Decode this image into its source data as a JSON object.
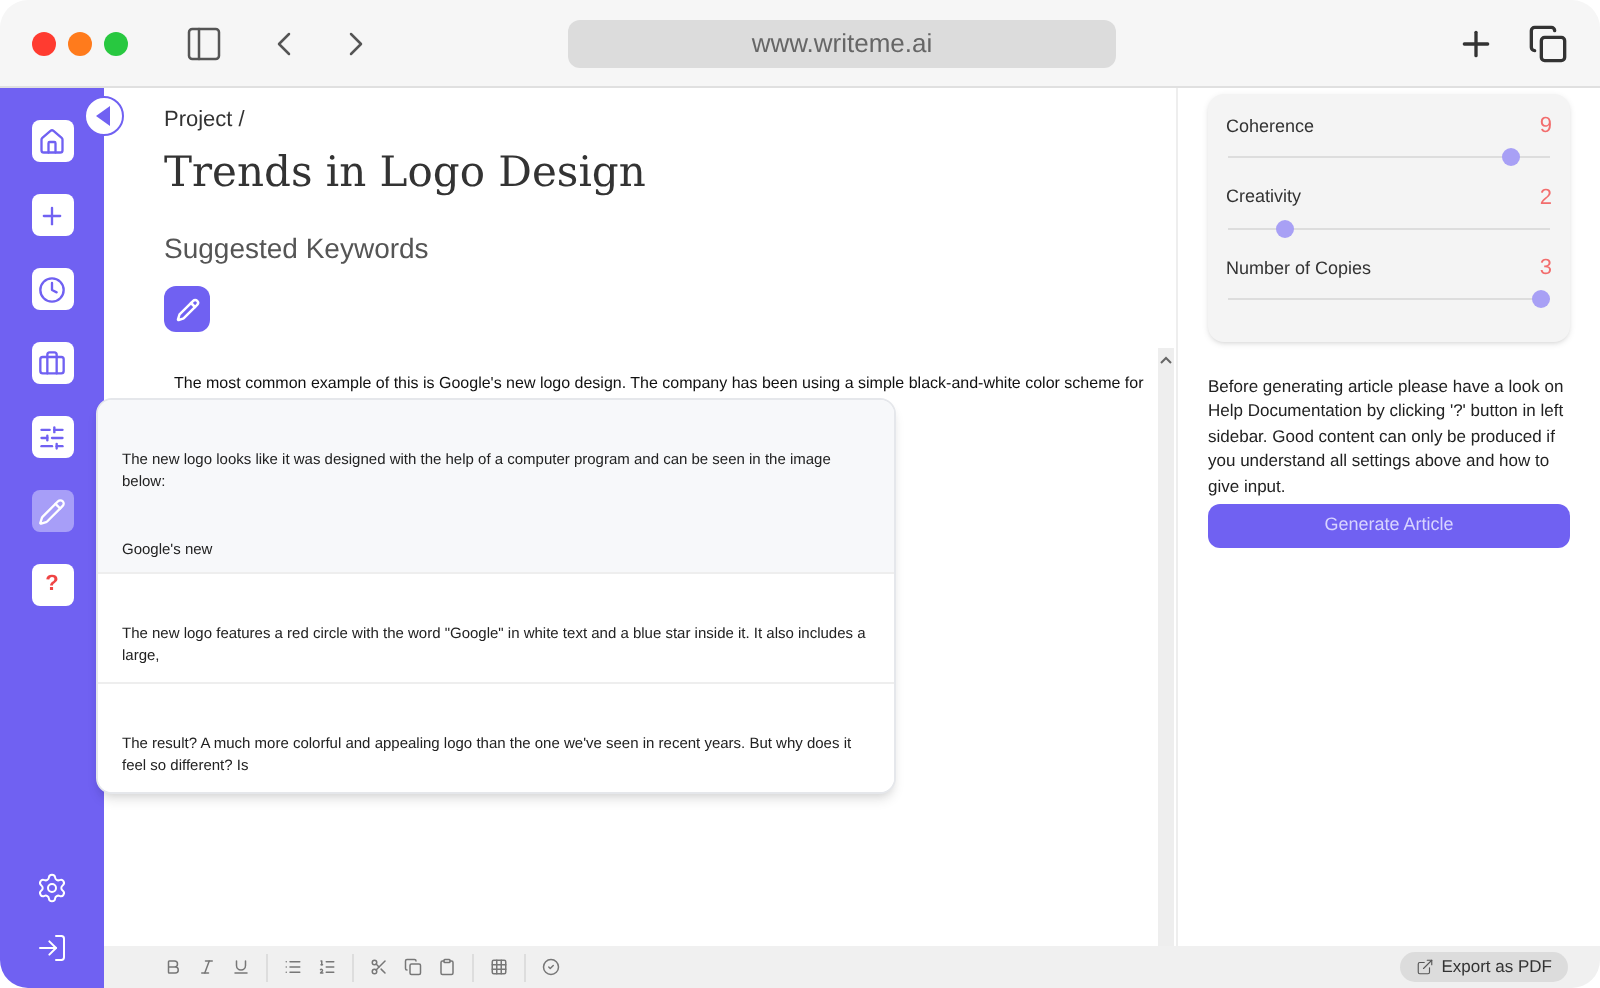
{
  "browser": {
    "url": "www.writeme.ai"
  },
  "sidebar": {
    "items": [
      {
        "selected": false
      },
      {
        "selected": false
      },
      {
        "selected": false
      },
      {
        "selected": false
      },
      {
        "selected": false
      },
      {
        "selected": true
      },
      {
        "selected": false,
        "label": "?"
      }
    ]
  },
  "header": {
    "breadcrumb": "Project /",
    "title": "Trends in Logo Design",
    "subtitle": "Suggested Keywords"
  },
  "editor": {
    "text": "The most common example of this is Google's new logo design. The company has been using a simple black-and-white color scheme for",
    "suggestions": [
      {
        "selected": true,
        "lines": [
          "The new logo looks like it was designed with the help of a computer program and can be seen in the image below:",
          "Google's new"
        ]
      },
      {
        "selected": false,
        "lines": [
          "The new logo features a red circle with the word \"Google\" in white text and a blue star inside it. It also includes a large,"
        ]
      },
      {
        "selected": false,
        "lines": [
          "The result? A much more colorful and appealing logo than the one we've seen in recent years. But why does it feel so different? Is"
        ]
      }
    ]
  },
  "settings": [
    {
      "name": "Coherence",
      "value": "9",
      "level": 0.9
    },
    {
      "name": "Creativity",
      "value": "2",
      "level": 0.16
    },
    {
      "name": "Number of Copies",
      "value": "3",
      "level": 1
    }
  ],
  "note": "Before generating article please have a look on Help Documentation by clicking '?' button in left sidebar. Good content can only be produced if you understand all settings above and how to give input.",
  "generate_button": "Generate Article",
  "export_button": "Export as PDF"
}
